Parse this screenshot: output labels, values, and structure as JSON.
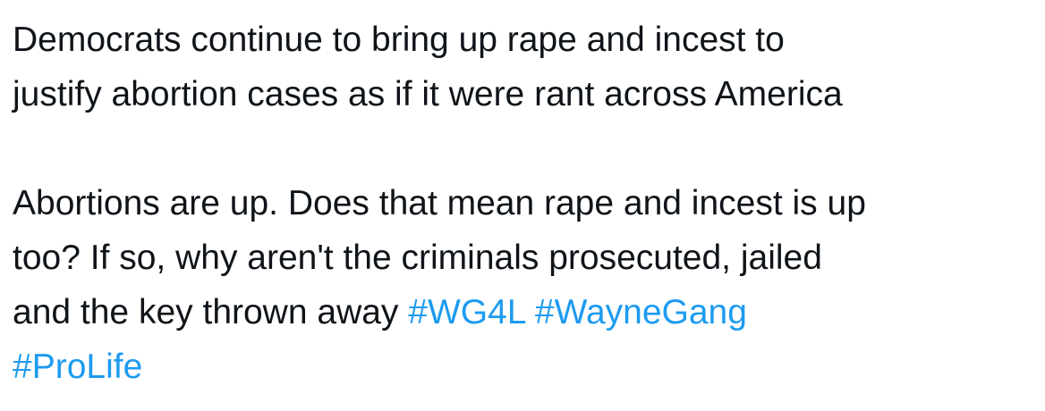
{
  "tweet": {
    "paragraph1": {
      "line1": "Democrats continue to bring up rape and incest to",
      "line2": "justify abortion cases as if it were rant across America"
    },
    "paragraph2": {
      "line1": "Abortions are up. Does that mean rape and incest is up",
      "line2": "too? If so, why aren't the criminals prosecuted, jailed",
      "line3_text": "and the key thrown away "
    },
    "hashtags": [
      "#WG4L",
      "#WayneGang",
      "#ProLife"
    ],
    "colors": {
      "text": "#0f1419",
      "hashtag": "#1d9bf0",
      "background": "#ffffff"
    }
  }
}
